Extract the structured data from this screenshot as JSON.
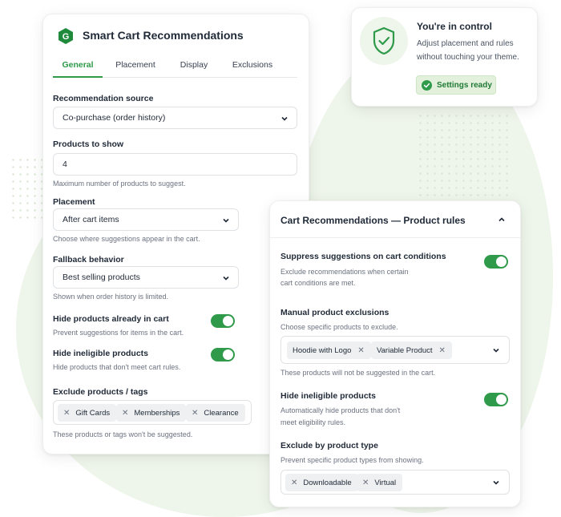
{
  "settings": {
    "app_title": "Smart Cart Recommendations",
    "tabs": [
      "General",
      "Placement",
      "Display",
      "Exclusions"
    ],
    "rec_source": {
      "label": "Recommendation source",
      "value": "Co-purchase (order history)"
    },
    "products_to_show": {
      "label": "Products to show",
      "value": "4",
      "help": "Maximum number of products to suggest."
    },
    "placement": {
      "label": "Placement",
      "value": "After cart items",
      "help": "Choose where suggestions appear in the cart."
    },
    "fallback": {
      "label": "Fallback behavior",
      "value": "Best selling products",
      "help": "Shown when order history is limited."
    },
    "hide_in_cart": {
      "label": "Hide products already in cart",
      "help": "Prevent suggestions for items in the cart.",
      "enabled": true
    },
    "hide_ineligible": {
      "label": "Hide ineligible products",
      "help": "Hide products that don't meet cart rules.",
      "enabled": true
    },
    "exclude": {
      "label": "Exclude products / tags",
      "tags": [
        "Gift Cards",
        "Memberships",
        "Clearance"
      ],
      "help": "These products or tags won't be suggested."
    }
  },
  "control": {
    "title": "You're in control",
    "body_line1": "Adjust placement and rules",
    "body_line2": "without touching your theme.",
    "badge": "Settings ready"
  },
  "rules": {
    "title": "Cart Recommendations — Product rules",
    "suppress": {
      "label": "Suppress suggestions on cart conditions",
      "help_line1": "Exclude recommendations when certain",
      "help_line2": "cart conditions are met.",
      "enabled": true
    },
    "manual": {
      "label": "Manual product exclusions",
      "help": "Choose specific products to exclude.",
      "tags": [
        "Hoodie with Logo",
        "Variable Product"
      ],
      "note": "These products will not be suggested in the cart."
    },
    "ineligible": {
      "label": "Hide ineligible products",
      "help_line1": "Automatically hide products that don't",
      "help_line2": "meet eligibility rules.",
      "enabled": true
    },
    "by_type": {
      "label": "Exclude by product type",
      "help": "Prevent specific product types from showing.",
      "tags": [
        "Downloadable",
        "Virtual"
      ]
    }
  },
  "colors": {
    "accent": "#2e9a4a",
    "background_tint": "#eef5ea"
  },
  "icons": {
    "logo": "app-logo-icon",
    "shield": "shield-check-icon",
    "check": "check-circle-icon",
    "chevron": "chevron-down-icon",
    "collapse": "chevron-up-icon",
    "remove": "close-icon"
  }
}
